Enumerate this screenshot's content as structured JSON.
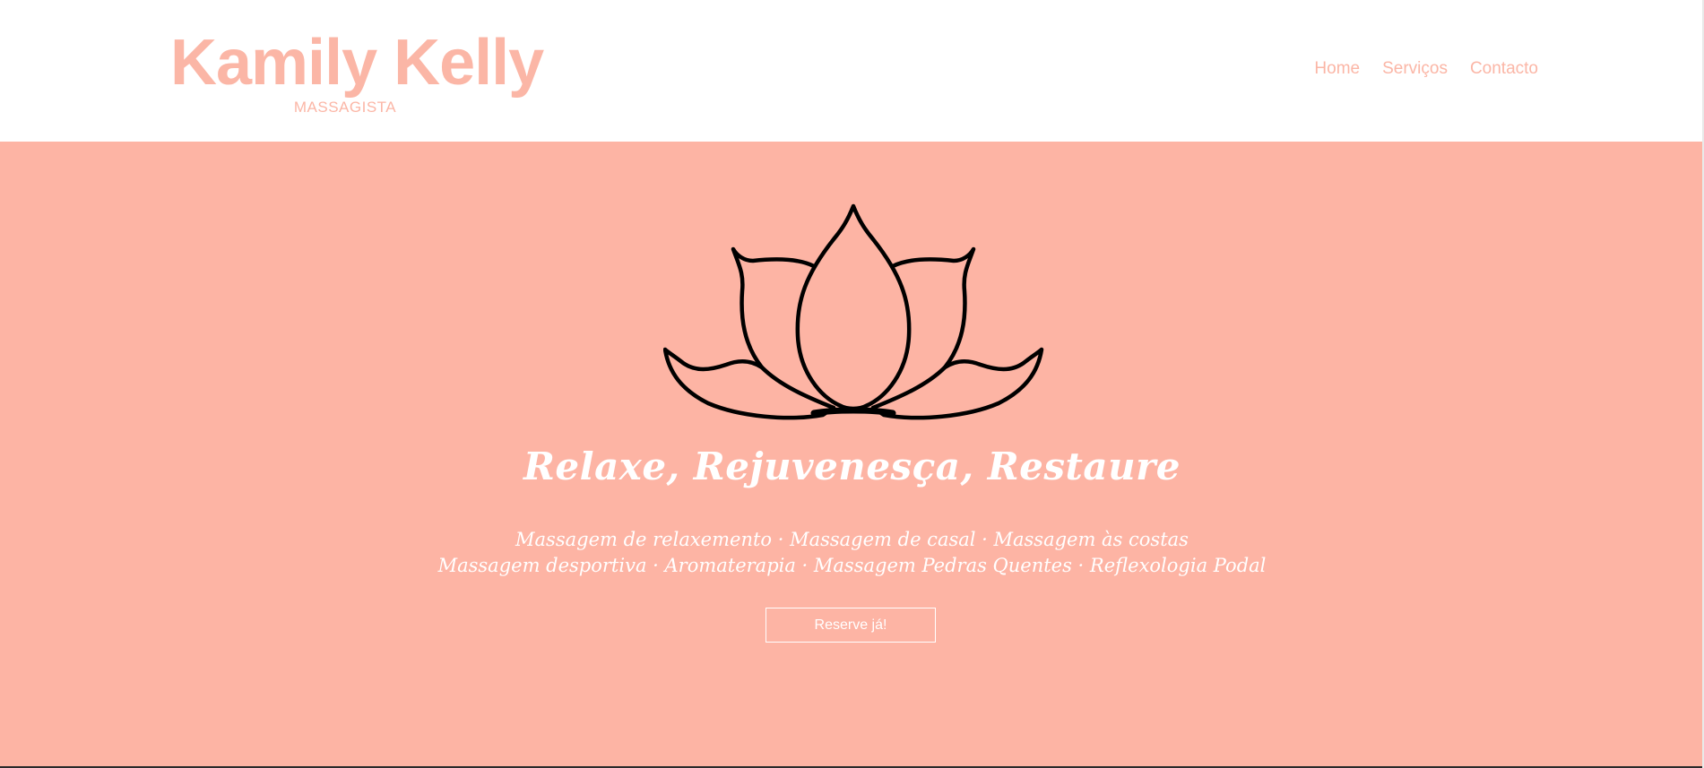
{
  "brand": {
    "name": "Kamily Kelly",
    "subtitle": "MASSAGISTA",
    "color": "#fbb6a6"
  },
  "nav": {
    "items": [
      {
        "label": "Home"
      },
      {
        "label": "Serviços"
      },
      {
        "label": "Contacto"
      }
    ]
  },
  "hero": {
    "background": "#fdb4a4",
    "icon": "lotus-flower-icon",
    "title": "Relaxe, Rejuvenesça, Restaure",
    "services_line1": "Massagem de relaxemento · Massagem de casal · Massagem às costas",
    "services_line2": "Massagem desportiva · Aromaterapia · Massagem Pedras Quentes · Reflexologia Podal",
    "cta_label": "Reserve já!"
  }
}
